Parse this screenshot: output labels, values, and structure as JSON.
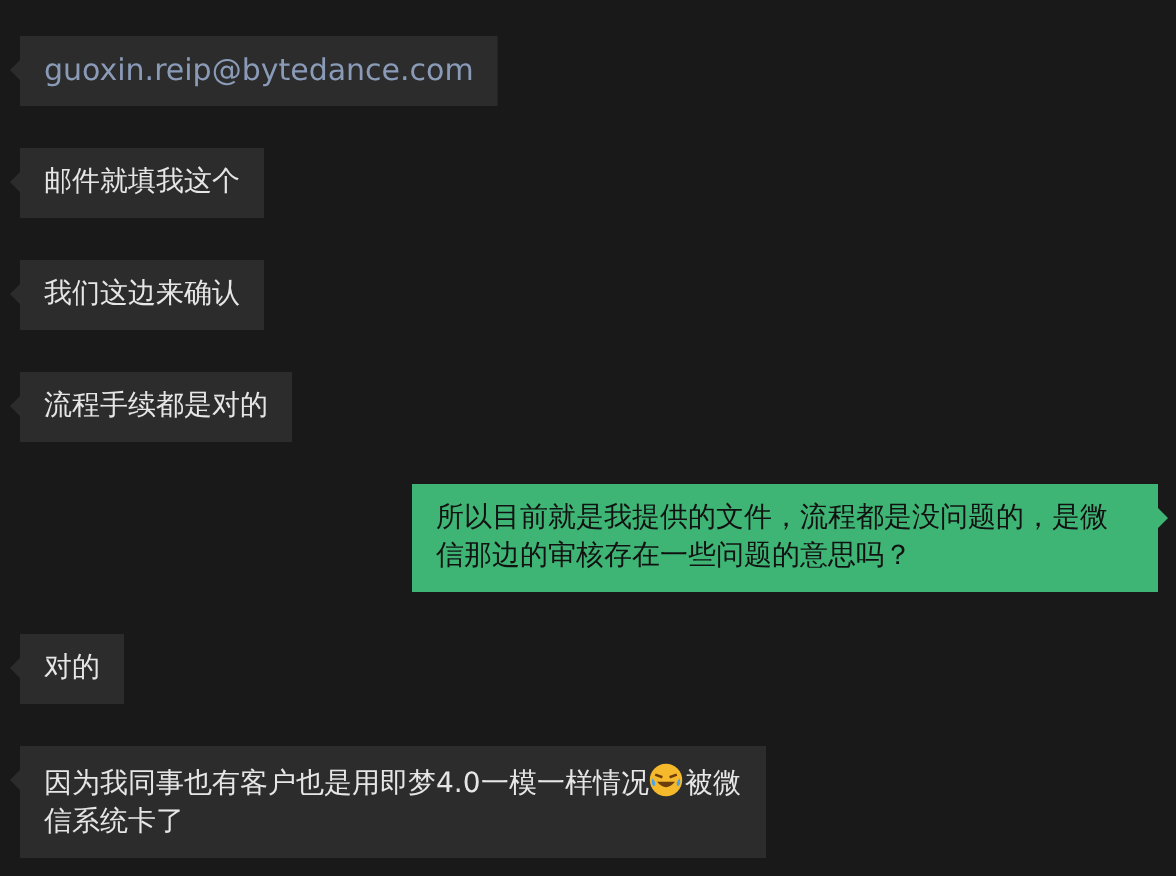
{
  "messages": [
    {
      "sent": false,
      "kind": "email",
      "parts": [
        {
          "kind": "text",
          "text": "guoxin.reip@bytedance.com"
        }
      ]
    },
    {
      "sent": false,
      "kind": "plain",
      "parts": [
        {
          "kind": "text",
          "text": "邮件就填我这个"
        }
      ]
    },
    {
      "sent": false,
      "kind": "plain",
      "parts": [
        {
          "kind": "text",
          "text": "我们这边来确认"
        }
      ]
    },
    {
      "sent": false,
      "kind": "plain",
      "parts": [
        {
          "kind": "text",
          "text": "流程手续都是对的"
        }
      ]
    },
    {
      "sent": true,
      "kind": "plain",
      "parts": [
        {
          "kind": "text",
          "text": "所以目前就是我提供的文件，流程都是没问题的，是微信那边的审核存在一些问题的意思吗？"
        }
      ]
    },
    {
      "sent": false,
      "kind": "plain",
      "parts": [
        {
          "kind": "text",
          "text": "对的"
        }
      ]
    },
    {
      "sent": false,
      "kind": "plain",
      "parts": [
        {
          "kind": "text",
          "text": "因为我同事也有客户也是用即梦4.0一模一样情况"
        },
        {
          "kind": "emoji"
        },
        {
          "kind": "text",
          "text": "被微"
        },
        {
          "kind": "text",
          "text": "信系统卡了"
        }
      ]
    }
  ]
}
